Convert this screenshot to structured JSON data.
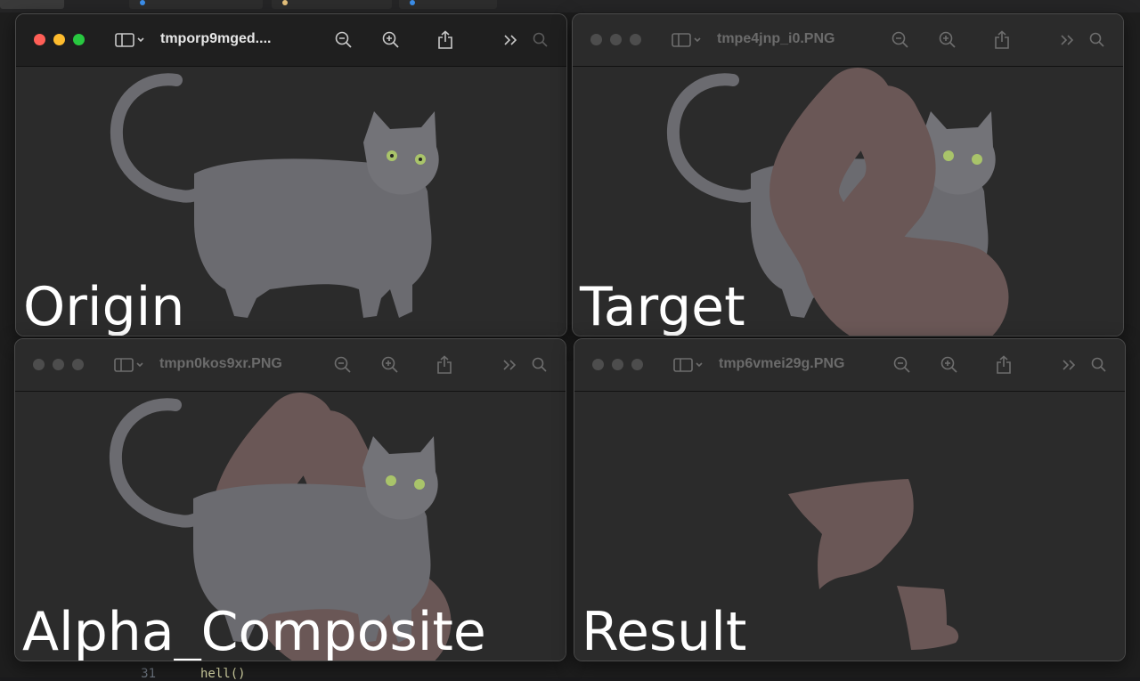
{
  "editor": {
    "line_number": "31",
    "code_text": "hell()"
  },
  "windows": [
    {
      "title": "tmporp9mged....",
      "label": "Origin",
      "active": true
    },
    {
      "title": "tmpe4jnp_i0.PNG",
      "label": "Target",
      "active": false
    },
    {
      "title": "tmpn0kos9xr.PNG",
      "label": "Alpha_Composite",
      "active": false
    },
    {
      "title": "tmp6vmei29g.PNG",
      "label": "Result",
      "active": false
    }
  ],
  "colors": {
    "mask": "#6a5756",
    "cat": "#6b6b70",
    "content_bg": "#2b2b2b",
    "traffic_close": "#ff5f57",
    "traffic_min": "#febc2e",
    "traffic_max": "#28c840"
  },
  "icons": [
    "sidebar-icon",
    "zoom-out-icon",
    "zoom-in-icon",
    "share-icon",
    "more-icon",
    "search-icon"
  ]
}
